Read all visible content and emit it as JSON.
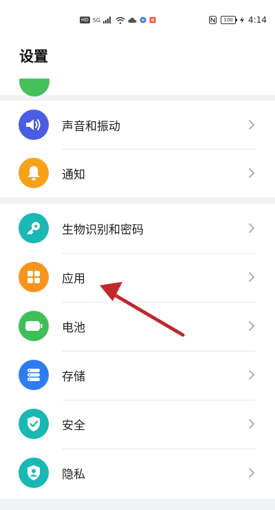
{
  "status_bar": {
    "hd_badge": "HD",
    "network": "5G",
    "battery": "100",
    "time": "4:14"
  },
  "header": {
    "title": "设置"
  },
  "groups": [
    {
      "items": [
        {
          "label": "声音和振动",
          "icon": "speaker-icon",
          "color": "#4a5de3"
        },
        {
          "label": "通知",
          "icon": "bell-icon",
          "color": "#f7a11a"
        }
      ]
    },
    {
      "items": [
        {
          "label": "生物识别和密码",
          "icon": "key-icon",
          "color": "#1ab8b4"
        },
        {
          "label": "应用",
          "icon": "apps-icon",
          "color": "#f7941d"
        },
        {
          "label": "电池",
          "icon": "battery-icon",
          "color": "#3fbf58"
        },
        {
          "label": "存储",
          "icon": "storage-icon",
          "color": "#2d7df0"
        },
        {
          "label": "安全",
          "icon": "shield-check-icon",
          "color": "#1ab8b4"
        },
        {
          "label": "隐私",
          "icon": "privacy-icon",
          "color": "#1ab8b4"
        }
      ]
    }
  ],
  "colors": {
    "annotation_arrow": "#c0282b",
    "background": "#f1f2f4"
  }
}
